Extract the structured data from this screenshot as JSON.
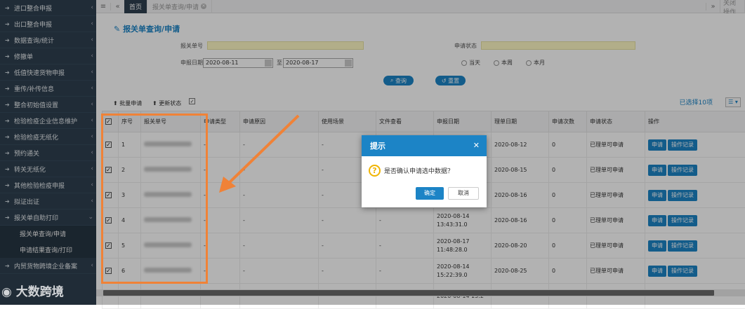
{
  "sidebar": {
    "items": [
      {
        "icon": "➔",
        "label": "进口整合申报",
        "arrow": "‹"
      },
      {
        "icon": "➔",
        "label": "出口整合申报",
        "arrow": "‹"
      },
      {
        "icon": "➔",
        "label": "数据查询/统计",
        "arrow": "‹"
      },
      {
        "icon": "➔",
        "label": "修撤单",
        "arrow": "‹"
      },
      {
        "icon": "➔",
        "label": "低值快速货物申报",
        "arrow": "‹"
      },
      {
        "icon": "➔",
        "label": "重传/补传信息",
        "arrow": "‹"
      },
      {
        "icon": "➔",
        "label": "整合初始值设置",
        "arrow": "‹"
      },
      {
        "icon": "➔",
        "label": "检验检疫企业信息维护",
        "arrow": "‹"
      },
      {
        "icon": "➔",
        "label": "检验检疫无纸化",
        "arrow": "‹"
      },
      {
        "icon": "➔",
        "label": "预约通关",
        "arrow": "‹"
      },
      {
        "icon": "➔",
        "label": "转关无纸化",
        "arrow": "‹"
      },
      {
        "icon": "➔",
        "label": "其他检验检疫申报",
        "arrow": "‹"
      },
      {
        "icon": "➔",
        "label": "拟证出证",
        "arrow": "‹"
      },
      {
        "icon": "➔",
        "label": "报关单自助打印",
        "arrow": "⌄"
      }
    ],
    "subitems": [
      "报关单查询/申请",
      "申请结果查询/打印"
    ],
    "more": [
      {
        "icon": "➔",
        "label": "内贸货物跨境企业备案",
        "arrow": "‹"
      }
    ]
  },
  "topbar": {
    "tabs": [
      {
        "label": "首页"
      },
      {
        "label": "报关单查询/申请"
      }
    ],
    "right_label": "关闭操作"
  },
  "page": {
    "title": "报关单查询/申请"
  },
  "form": {
    "decl_no_label": "报关单号",
    "status_label": "申请状态",
    "date_label": "申报日期",
    "date_from": "2020-08-11",
    "date_to_label": "至",
    "date_to": "2020-08-17",
    "radios": [
      "当天",
      "本周",
      "本月"
    ],
    "search_button": "查询",
    "reset_button": "重置"
  },
  "toolbar": {
    "batch_apply": "批量申请",
    "update_status": "更新状态",
    "selected_info": "已选择10项"
  },
  "table": {
    "headers": [
      "序号",
      "报关单号",
      "申请类型",
      "申请原因",
      "使用场景",
      "文件查看",
      "申报日期",
      "理单日期",
      "申请次数",
      "申请状态",
      "操作"
    ],
    "rows": [
      {
        "no": "1",
        "type": "-",
        "reason": "-",
        "scene": "-",
        "file": "-",
        "decl_date": "",
        "tidy_date": "2020-08-12",
        "count": "0",
        "status": "已理单可申请"
      },
      {
        "no": "2",
        "type": "-",
        "reason": "-",
        "scene": "-",
        "file": "-",
        "decl_date": "",
        "tidy_date": "2020-08-15",
        "count": "0",
        "status": "已理单可申请"
      },
      {
        "no": "3",
        "type": "-",
        "reason": "-",
        "scene": "-",
        "file": "-",
        "decl_date": "",
        "tidy_date": "2020-08-16",
        "count": "0",
        "status": "已理单可申请"
      },
      {
        "no": "4",
        "type": "-",
        "reason": "-",
        "scene": "-",
        "file": "-",
        "decl_date": "2020-08-14 13:43:31.0",
        "tidy_date": "2020-08-16",
        "count": "0",
        "status": "已理单可申请"
      },
      {
        "no": "5",
        "type": "-",
        "reason": "-",
        "scene": "-",
        "file": "-",
        "decl_date": "2020-08-17 11:48:28.0",
        "tidy_date": "2020-08-20",
        "count": "0",
        "status": "已理单可申请"
      },
      {
        "no": "6",
        "type": "-",
        "reason": "-",
        "scene": "-",
        "file": "-",
        "decl_date": "2020-08-14 15:22:39.0",
        "tidy_date": "2020-08-25",
        "count": "0",
        "status": "已理单可申请"
      }
    ],
    "partial_row_date": "2020-08-14 15:2",
    "action_apply": "申请",
    "action_log": "操作记录"
  },
  "dialog": {
    "title": "提示",
    "message": "是否确认申请选中数据？",
    "ok": "确定",
    "cancel": "取消"
  },
  "watermark": "大数跨境",
  "colors": {
    "sidebar": "#2f4050",
    "accent": "#1c84c6",
    "highlight": "#f08237",
    "input_bg": "#fff9c4"
  }
}
